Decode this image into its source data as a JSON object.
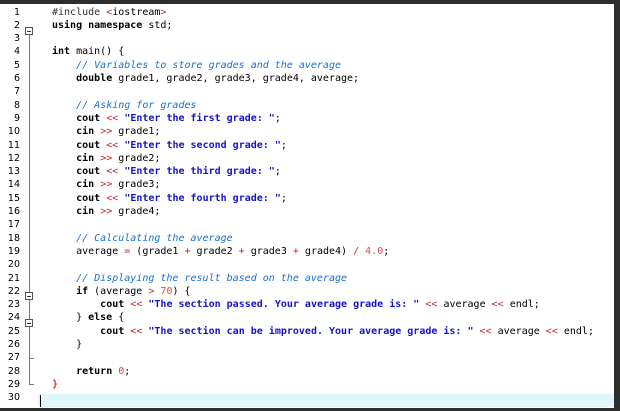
{
  "editor": {
    "lines": [
      {
        "n": "1",
        "t": "#include <iostream>"
      },
      {
        "n": "2",
        "t": "using namespace std;"
      },
      {
        "n": "3",
        "t": ""
      },
      {
        "n": "4",
        "t": "int main() {"
      },
      {
        "n": "5",
        "t": "    // Variables to store grades and the average"
      },
      {
        "n": "6",
        "t": "    double grade1, grade2, grade3, grade4, average;"
      },
      {
        "n": "7",
        "t": ""
      },
      {
        "n": "8",
        "t": "    // Asking for grades"
      },
      {
        "n": "9",
        "t": "    cout << \"Enter the first grade: \";"
      },
      {
        "n": "10",
        "t": "    cin >> grade1;"
      },
      {
        "n": "11",
        "t": "    cout << \"Enter the second grade: \";"
      },
      {
        "n": "12",
        "t": "    cin >> grade2;"
      },
      {
        "n": "13",
        "t": "    cout << \"Enter the third grade: \";"
      },
      {
        "n": "14",
        "t": "    cin >> grade3;"
      },
      {
        "n": "15",
        "t": "    cout << \"Enter the fourth grade: \";"
      },
      {
        "n": "16",
        "t": "    cin >> grade4;"
      },
      {
        "n": "17",
        "t": ""
      },
      {
        "n": "18",
        "t": "    // Calculating the average"
      },
      {
        "n": "19",
        "t": "    average = (grade1 + grade2 + grade3 + grade4) / 4.0;"
      },
      {
        "n": "20",
        "t": ""
      },
      {
        "n": "21",
        "t": "    // Displaying the result based on the average"
      },
      {
        "n": "22",
        "t": "    if (average > 70) {"
      },
      {
        "n": "23",
        "t": "        cout << \"The section passed. Your average grade is: \" << average << endl;"
      },
      {
        "n": "24",
        "t": "    } else {"
      },
      {
        "n": "25",
        "t": "        cout << \"The section can be improved. Your average grade is: \" << average << endl;"
      },
      {
        "n": "26",
        "t": "    }"
      },
      {
        "n": "27",
        "t": ""
      },
      {
        "n": "28",
        "t": "    return 0;"
      },
      {
        "n": "29",
        "t": "}"
      },
      {
        "n": "30",
        "t": ""
      }
    ]
  },
  "colors": {
    "string": "#1414c8",
    "comment": "#1b6fd4",
    "number": "#e14b4b",
    "operator": "#c0292b",
    "current_line": "#dff7fb",
    "background": "#ffffff"
  }
}
